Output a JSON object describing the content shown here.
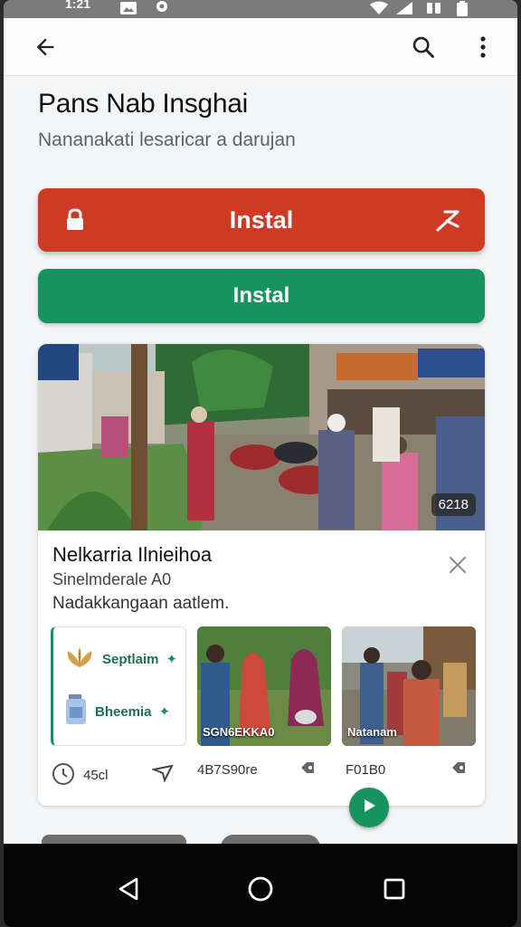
{
  "status_bar": {
    "time": "1:21",
    "icons": [
      "image-icon",
      "sync-icon",
      "wifi-icon",
      "signal-icon",
      "battery-icon"
    ]
  },
  "app_bar": {
    "icons": [
      "back-arrow-icon",
      "search-icon",
      "more-vert-icon"
    ]
  },
  "header": {
    "title": "Pans Nab Insghai",
    "subtitle": "Nananakati lesaricar a darujan"
  },
  "actions": {
    "primary_label": "Instal",
    "secondary_label": "Instal",
    "colors": {
      "primary": "#cf3a25",
      "secondary": "#17935f"
    }
  },
  "card": {
    "hero_badge": "6218",
    "title": "Nelkarria Ilnieihoa",
    "subtitle": "Sinelmderale A0",
    "description": "Nadakkangaan aatlem.",
    "tiles": [
      {
        "rows": [
          "Septlaim",
          "Bheemia"
        ],
        "footer": "45cl"
      },
      {
        "caption": "SGN6EKKA0",
        "footer": "4B7S90re"
      },
      {
        "caption": "Natanam",
        "footer": "F01B0"
      }
    ]
  },
  "nav_bar": {
    "icons": [
      "back-triangle-icon",
      "home-circle-icon",
      "recents-square-icon"
    ]
  }
}
